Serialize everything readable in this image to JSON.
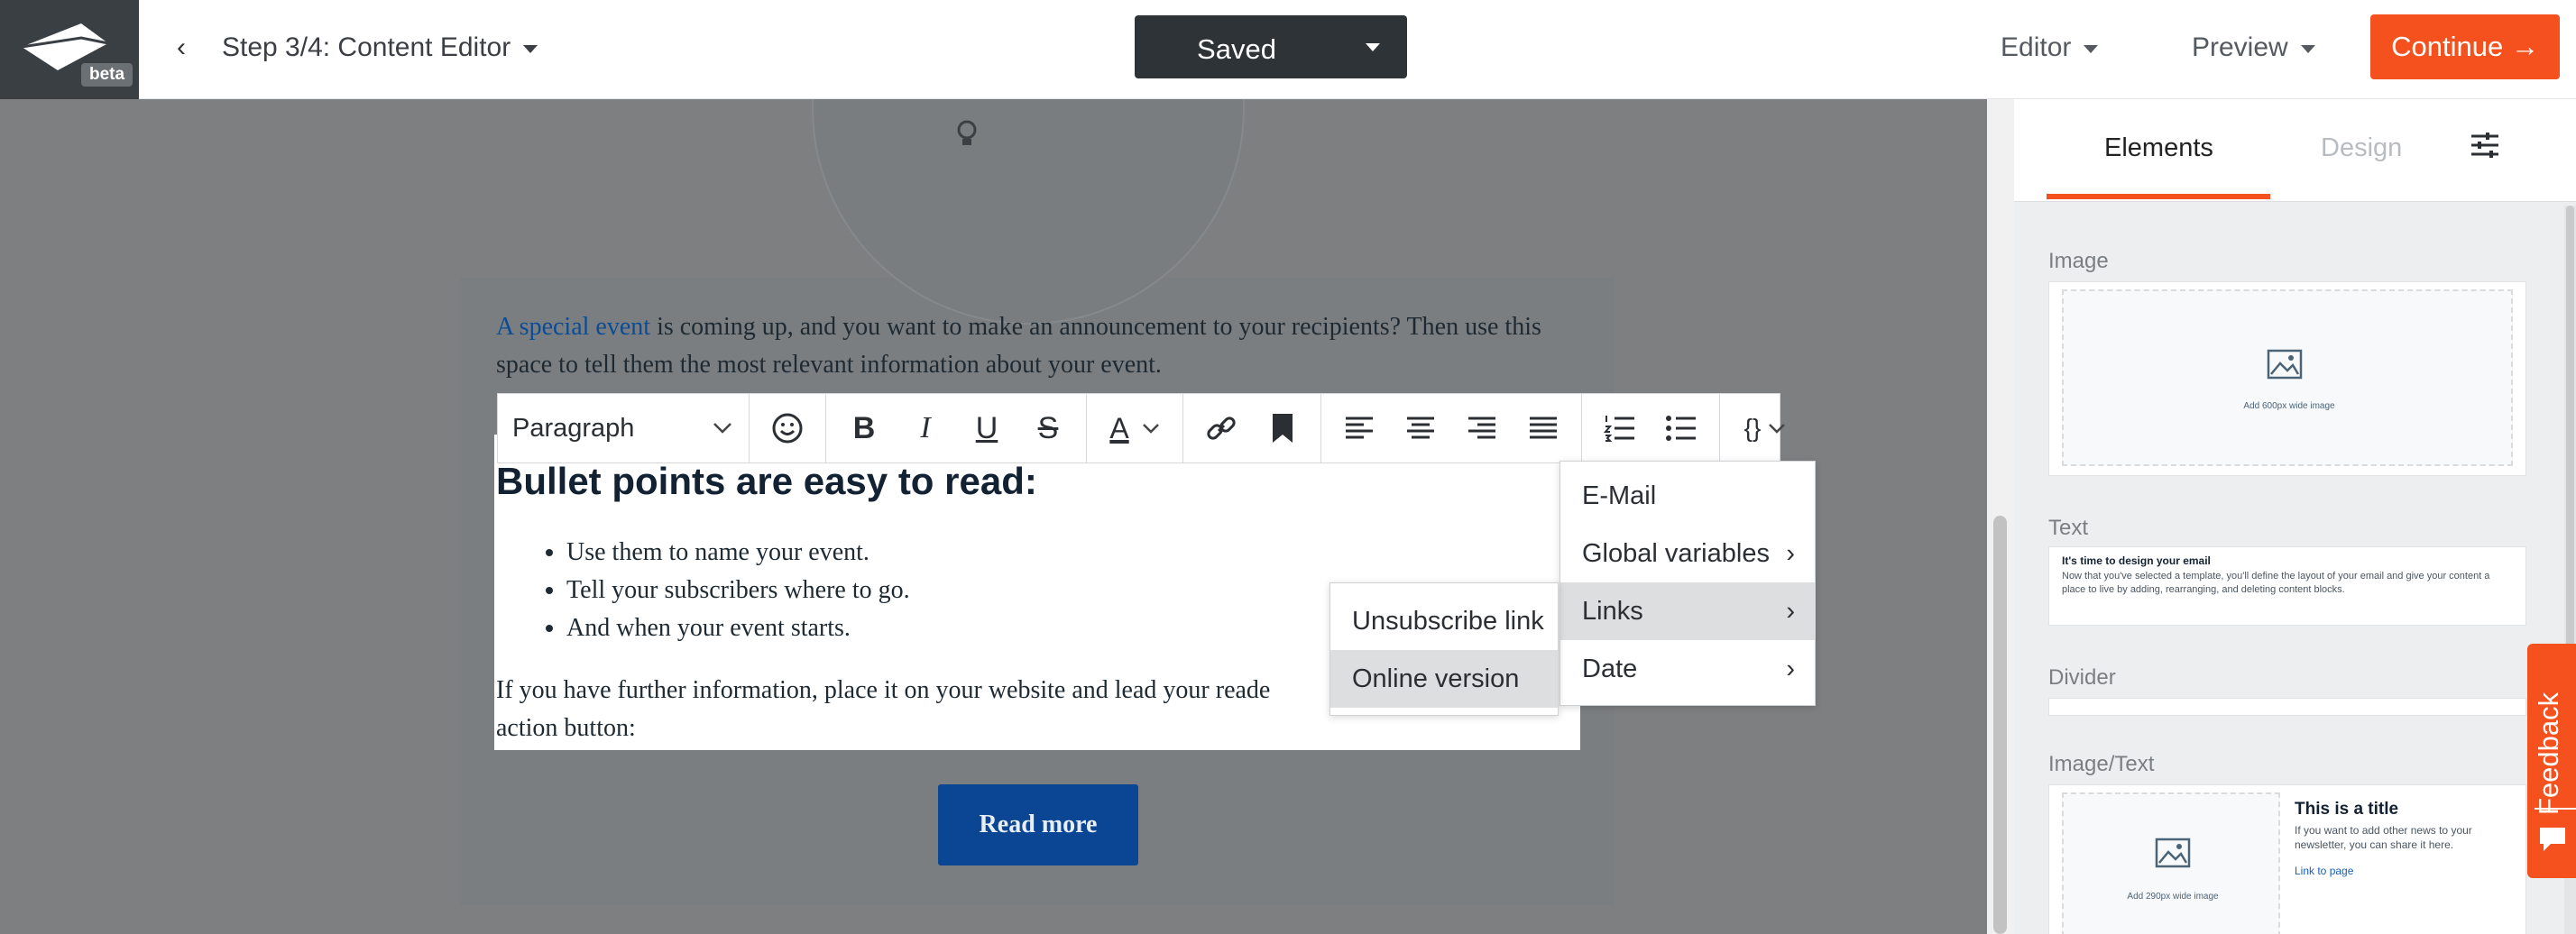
{
  "header": {
    "beta_badge": "beta",
    "back_icon": "chevron-left-icon",
    "step_label": "Step 3/4: Content Editor",
    "saved_label": "Saved",
    "editor_label": "Editor",
    "preview_label": "Preview",
    "continue_label": "Continue →"
  },
  "content": {
    "intro_link": "A special event",
    "intro_rest": " is coming up, and you want to make an announcement to your recipients? Then use this space to tell them the most relevant information about your event.",
    "heading": "Bullet points are easy to read:",
    "bullets": [
      "Use them to name your event.",
      "Tell your subscribers where to go.",
      "And when your event starts."
    ],
    "para": "If you have further information, place it on your website and lead your readers there with a call to action button:",
    "para_visible_1": "If you have further information, place it on your website and lead your reade",
    "para_visible_2": "action button:",
    "button_label": "Read more"
  },
  "toolbar": {
    "paragraph_select": "Paragraph",
    "placeholder_button": "{}",
    "icons": [
      "emoji-icon",
      "bold-icon",
      "italic-icon",
      "underline-icon",
      "strikethrough-icon",
      "text-color-icon",
      "link-icon",
      "bookmark-icon",
      "align-left-icon",
      "align-center-icon",
      "align-right-icon",
      "align-justify-icon",
      "ordered-list-icon",
      "bullet-list-icon"
    ]
  },
  "placeholder_menu": {
    "items": [
      "E-Mail",
      "Global variables",
      "Links",
      "Date"
    ],
    "active": "Links"
  },
  "links_submenu": {
    "items": [
      "Unsubscribe link",
      "Online version"
    ],
    "active": "Online version"
  },
  "panel": {
    "tab_elements": "Elements",
    "tab_design": "Design",
    "sections": {
      "image": "Image",
      "text": "Text",
      "divider": "Divider",
      "image_text": "Image/Text"
    },
    "image_card_caption": "Add 600px wide image",
    "text_card_title": "It's time to design your email",
    "text_card_body": "Now that you've selected a template, you'll define the layout of your email and give your content a place to live by adding, rearranging, and deleting content blocks.",
    "imagetext_caption": "Add 290px wide image",
    "imagetext_title": "This is a title",
    "imagetext_body": "If you want to add other news to your newsletter, you can share it here.",
    "imagetext_link": "Link to page"
  },
  "feedback_label": "Feedback",
  "colors": {
    "accent": "#f4511e",
    "saved_bg": "#2e3338",
    "cta_button": "#0a4694",
    "link": "#0b4c94"
  }
}
